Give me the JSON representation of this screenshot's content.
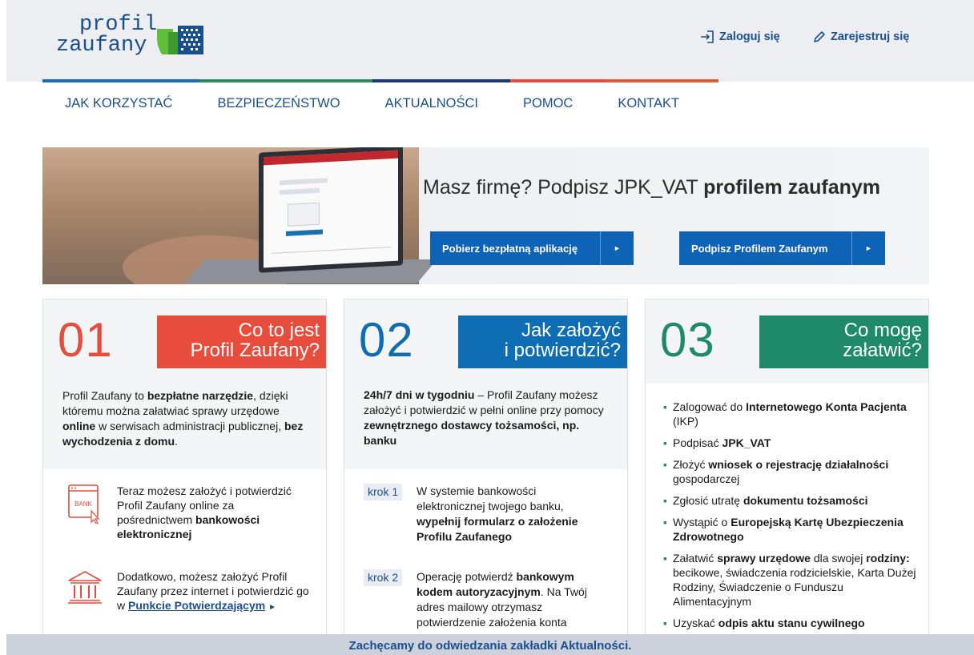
{
  "header": {
    "logo_line1": "profil",
    "logo_line2": "zaufany",
    "login_label": "Zaloguj się",
    "register_label": "Zarejestruj się"
  },
  "colors": {
    "brand_blue": "#1a4f8e",
    "button_blue": "#0f63b7",
    "red": "#e74c3c",
    "blue": "#0f6db3",
    "green": "#1f8a6a",
    "line_segments": [
      "#1a6fb0",
      "#2e8a5f",
      "#1d3a6e",
      "#e74c3c",
      "#d9603b"
    ]
  },
  "nav": {
    "items": [
      {
        "label": "JAK KORZYSTAĆ"
      },
      {
        "label": "BEZPIECZEŃSTWO"
      },
      {
        "label": "AKTUALNOŚCI"
      },
      {
        "label": "POMOC"
      },
      {
        "label": "KONTAKT"
      }
    ]
  },
  "banner": {
    "title_plain": "Masz firmę? Podpisz JPK_VAT ",
    "title_bold": "profilem zaufanym",
    "button1": "Pobierz bezpłatną aplikację",
    "button2": "Podpisz Profilem Zaufanym",
    "arrow": "►"
  },
  "cards": [
    {
      "number": "01",
      "title_line1": "Co to jest",
      "title_line2": "Profil Zaufany?",
      "lead": [
        {
          "t": "Profil Zaufany to ",
          "b": false
        },
        {
          "t": "bezpłatne narzędzie",
          "b": true
        },
        {
          "t": ", dzięki któremu można załatwiać sprawy urzędowe ",
          "b": false
        },
        {
          "t": "online",
          "b": true
        },
        {
          "t": " w serwisach administracji publicznej, ",
          "b": false
        },
        {
          "t": "bez wychodzenia z domu",
          "b": true
        },
        {
          "t": ".",
          "b": false
        }
      ],
      "features": [
        {
          "icon_label": "BANK",
          "text": [
            {
              "t": "Teraz możesz założyć i potwierdzić Profil Zaufany online za pośrednictwem ",
              "b": false
            },
            {
              "t": "bankowości elektronicznej",
              "b": true
            }
          ]
        },
        {
          "text_plain": "Dodatkowo, możesz założyć Profil Zaufany przez internet i potwierdzić go w ",
          "link": "Punkcie Potwierdzającym",
          "arrow": "►"
        }
      ]
    },
    {
      "number": "02",
      "title_line1": "Jak założyć",
      "title_line2": "i potwierdzić?",
      "lead": [
        {
          "t": "24h/7 dni w tygodniu",
          "b": true
        },
        {
          "t": " – Profil Zaufany możesz założyć i potwierdzić w pełni online przy pomocy ",
          "b": false
        },
        {
          "t": "zewnętrznego dostawcy tożsamości, np. banku",
          "b": true
        }
      ],
      "steps": [
        {
          "tag": "krok 1",
          "text": [
            {
              "t": "W systemie bankowości elektronicznej twojego banku, ",
              "b": false
            },
            {
              "t": "wypełnij formularz o założenie Profilu Zaufanego",
              "b": true
            }
          ]
        },
        {
          "tag": "krok 2",
          "text": [
            {
              "t": "Operację potwierdź ",
              "b": false
            },
            {
              "t": "bankowym kodem autoryzacyjnym",
              "b": true
            },
            {
              "t": ". Na Twój adres mailowy otrzymasz potwierdzenie założenia konta",
              "b": false
            }
          ]
        }
      ]
    },
    {
      "number": "03",
      "title_line1": "Co mogę",
      "title_line2": "załatwić?",
      "bullet": "▪",
      "items": [
        [
          {
            "t": "Zalogować do ",
            "b": false
          },
          {
            "t": "Internetowego Konta Pacjenta",
            "b": true
          },
          {
            "t": " (IKP)",
            "b": false
          }
        ],
        [
          {
            "t": "Podpisać ",
            "b": false
          },
          {
            "t": "JPK_VAT",
            "b": true
          }
        ],
        [
          {
            "t": "Złożyć ",
            "b": false
          },
          {
            "t": "wniosek o rejestrację działalności",
            "b": true
          },
          {
            "t": " gospodarczej",
            "b": false
          }
        ],
        [
          {
            "t": "Zgłosić utratę ",
            "b": false
          },
          {
            "t": "dokumentu tożsamości",
            "b": true
          }
        ],
        [
          {
            "t": "Wystąpić o ",
            "b": false
          },
          {
            "t": "Europejską Kartę Ubezpieczenia Zdrowotnego",
            "b": true
          }
        ],
        [
          {
            "t": "Załatwić ",
            "b": false
          },
          {
            "t": "sprawy urzędowe",
            "b": true
          },
          {
            "t": " dla swojej ",
            "b": false
          },
          {
            "t": "rodziny:",
            "b": true
          },
          {
            "t": " becikowe, świadczenia rodzicielskie, Karta Dużej Rodziny, Świadczenie o Funduszu Alimentacyjnym",
            "b": false
          }
        ],
        [
          {
            "t": "Uzyskać ",
            "b": false
          },
          {
            "t": "odpis aktu stanu cywilnego",
            "b": true
          }
        ]
      ]
    }
  ],
  "footer_notice": "Zachęcamy do odwiedzania zakładki Aktualności."
}
